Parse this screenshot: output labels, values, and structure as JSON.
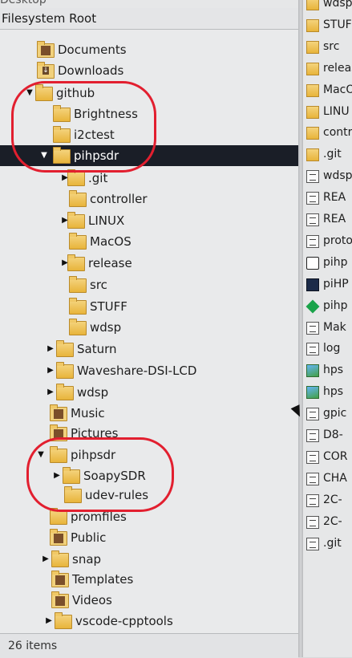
{
  "window": {
    "top_label": "Desktop",
    "pane_title": "Filesystem Root",
    "status_text": "26 items"
  },
  "tree": [
    {
      "label": "Documents",
      "icon": "documents-folder-icon",
      "expander": ""
    },
    {
      "label": "Downloads",
      "icon": "downloads-folder-icon",
      "expander": ""
    },
    {
      "label": "github",
      "icon": "folder-icon",
      "expander": "▼"
    },
    {
      "label": "Brightness",
      "icon": "folder-icon",
      "expander": ""
    },
    {
      "label": "i2ctest",
      "icon": "folder-icon",
      "expander": ""
    },
    {
      "label": "pihpsdr",
      "icon": "folder-icon",
      "expander": "▼",
      "selected": true
    },
    {
      "label": ".git",
      "icon": "folder-icon",
      "expander": "▶"
    },
    {
      "label": "controller",
      "icon": "folder-icon",
      "expander": ""
    },
    {
      "label": "LINUX",
      "icon": "folder-icon",
      "expander": "▶"
    },
    {
      "label": "MacOS",
      "icon": "folder-icon",
      "expander": ""
    },
    {
      "label": "release",
      "icon": "folder-icon",
      "expander": "▶"
    },
    {
      "label": "src",
      "icon": "folder-icon",
      "expander": ""
    },
    {
      "label": "STUFF",
      "icon": "folder-icon",
      "expander": ""
    },
    {
      "label": "wdsp",
      "icon": "folder-icon",
      "expander": ""
    },
    {
      "label": "Saturn",
      "icon": "folder-icon",
      "expander": "▶"
    },
    {
      "label": "Waveshare-DSI-LCD",
      "icon": "folder-icon",
      "expander": "▶"
    },
    {
      "label": "wdsp",
      "icon": "folder-icon",
      "expander": "▶"
    },
    {
      "label": "Music",
      "icon": "music-folder-icon",
      "expander": ""
    },
    {
      "label": "Pictures",
      "icon": "pictures-folder-icon",
      "expander": ""
    },
    {
      "label": "pihpsdr",
      "icon": "folder-icon",
      "expander": "▼"
    },
    {
      "label": "SoapySDR",
      "icon": "folder-icon",
      "expander": "▶"
    },
    {
      "label": "udev-rules",
      "icon": "folder-icon",
      "expander": ""
    },
    {
      "label": "promfiles",
      "icon": "folder-icon",
      "expander": ""
    },
    {
      "label": "Public",
      "icon": "public-folder-icon",
      "expander": ""
    },
    {
      "label": "snap",
      "icon": "folder-icon",
      "expander": "▶"
    },
    {
      "label": "Templates",
      "icon": "templates-folder-icon",
      "expander": ""
    },
    {
      "label": "Videos",
      "icon": "videos-folder-icon",
      "expander": ""
    },
    {
      "label": "vscode-cpptools",
      "icon": "folder-icon",
      "expander": "▶"
    }
  ],
  "right_pane": [
    {
      "label": "wdsp",
      "icon": "folder-icon"
    },
    {
      "label": "STUFF",
      "icon": "folder-icon"
    },
    {
      "label": "src",
      "icon": "folder-icon"
    },
    {
      "label": "releas",
      "icon": "folder-icon"
    },
    {
      "label": "MacO",
      "icon": "folder-icon"
    },
    {
      "label": "LINU",
      "icon": "folder-icon"
    },
    {
      "label": "contr",
      "icon": "folder-icon"
    },
    {
      "label": ".git",
      "icon": "folder-icon"
    },
    {
      "label": "wdsp",
      "icon": "text-file-icon"
    },
    {
      "label": "REA",
      "icon": "text-file-icon"
    },
    {
      "label": "REA",
      "icon": "text-file-icon"
    },
    {
      "label": "proto",
      "icon": "text-file-icon"
    },
    {
      "label": "pihp",
      "icon": "settings-file-icon"
    },
    {
      "label": "piHP",
      "icon": "dark-image-icon"
    },
    {
      "label": "pihp",
      "icon": "green-diamond-icon"
    },
    {
      "label": "Mak",
      "icon": "text-file-icon"
    },
    {
      "label": "log",
      "icon": "text-file-icon"
    },
    {
      "label": "hps",
      "icon": "image-file-icon"
    },
    {
      "label": "hps",
      "icon": "image-file-icon"
    },
    {
      "label": "gpic",
      "icon": "text-file-icon"
    },
    {
      "label": "D8-",
      "icon": "text-file-icon"
    },
    {
      "label": "COR",
      "icon": "text-file-icon"
    },
    {
      "label": "CHA",
      "icon": "text-file-icon"
    },
    {
      "label": "2C-",
      "icon": "text-file-icon"
    },
    {
      "label": "2C-",
      "icon": "text-file-icon"
    },
    {
      "label": ".git",
      "icon": "text-file-icon"
    }
  ],
  "annotations": {
    "circle_color": "#e21f2f"
  }
}
